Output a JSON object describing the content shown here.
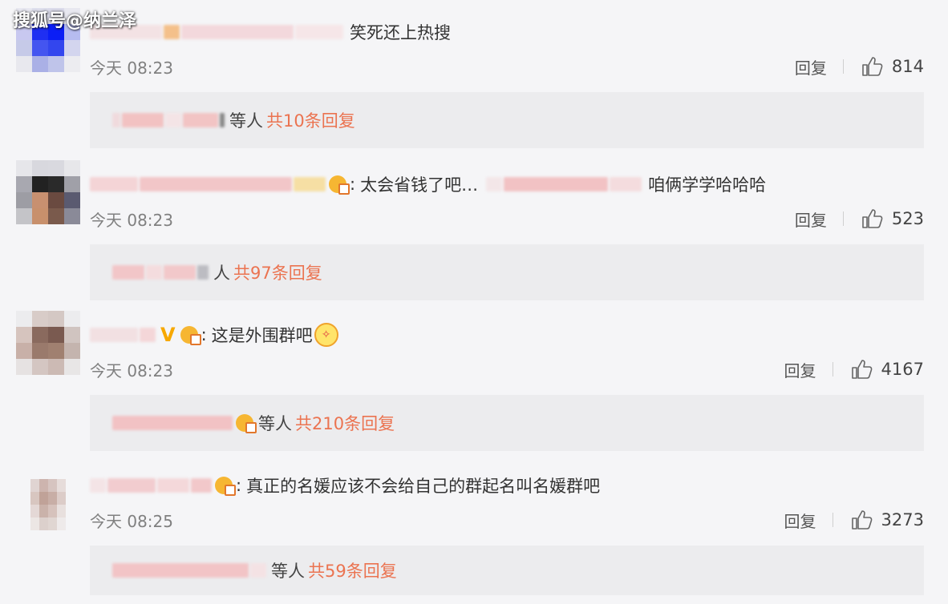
{
  "watermark": "搜狐号@纳兰泽",
  "reply_label": "回复",
  "comments": [
    {
      "text": "笑死还上热搜",
      "time": "今天 08:23",
      "likes": "814",
      "sub_suffix": "等人",
      "sub_count": "共10条回复"
    },
    {
      "text": "太会省钱了吧…",
      "text_tail": "咱俩学学哈哈哈",
      "time": "今天 08:23",
      "likes": "523",
      "sub_suffix": "人",
      "sub_count": "共97条回复"
    },
    {
      "text": "这是外围群吧",
      "time": "今天 08:23",
      "likes": "4167",
      "sub_suffix": "等人",
      "sub_count": "共210条回复"
    },
    {
      "text": "真正的名媛应该不会给自己的群起名叫名媛群吧",
      "time": "今天 08:25",
      "likes": "3273",
      "sub_suffix": "等人",
      "sub_count": "共59条回复"
    }
  ],
  "colors": {
    "accent": "#eb7350",
    "background": "#f5f5f7",
    "subreply_bg": "#ececee",
    "timestamp": "#808080"
  },
  "icons": [
    "thumbs-up-icon",
    "vip-badge-icon",
    "verified-v-icon",
    "emoji-icon"
  ]
}
